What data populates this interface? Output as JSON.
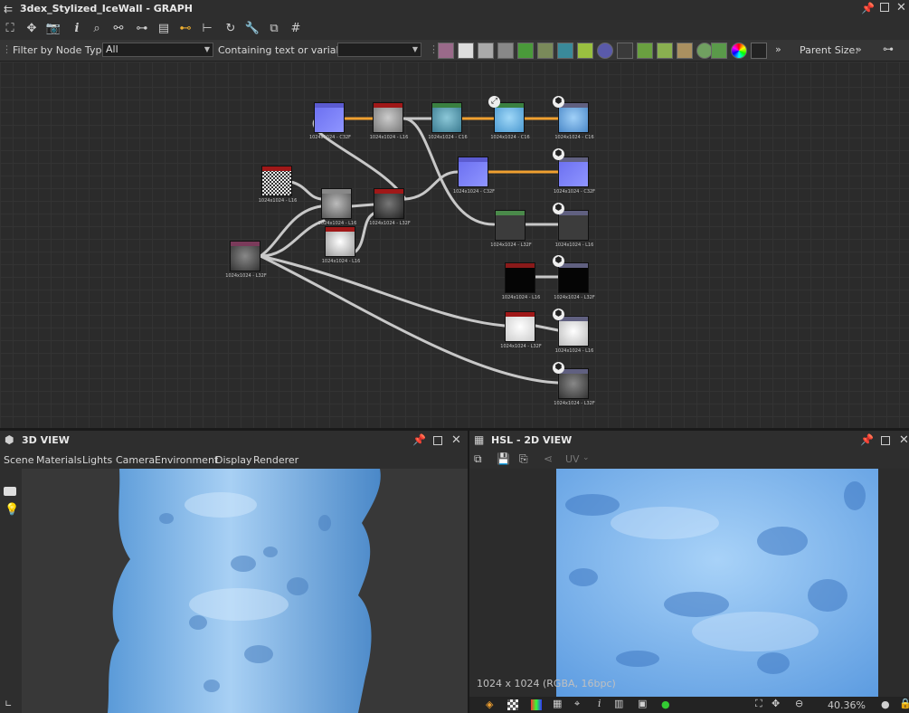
{
  "graph": {
    "title": "3dex_Stylized_IceWall - GRAPH",
    "filter_label": "Filter by Node Type",
    "filter_value": "All",
    "containing_label": "Containing text or variable",
    "containing_value": "",
    "parent_size_label": "Parent Size:",
    "nodes": [
      {
        "label": "1024x1024 - C32F"
      },
      {
        "label": "1024x1024 - L16"
      },
      {
        "label": "1024x1024 - C16"
      },
      {
        "label": "1024x1024 - C16"
      },
      {
        "label": "1024x1024 - C16"
      },
      {
        "label": "1024x1024 - C32F"
      },
      {
        "label": "1024x1024 - C32F"
      },
      {
        "label": "1024x1024 - L16"
      },
      {
        "label": "1024x1024 - L16"
      },
      {
        "label": "1024x1024 - L16"
      },
      {
        "label": "1024x1024 - L32F"
      },
      {
        "label": "1024x1024 - L32F"
      },
      {
        "label": "1024x1024 - L32F"
      },
      {
        "label": "1024x1024 - L16"
      },
      {
        "label": "1024x1024 - L16"
      },
      {
        "label": "1024x1024 - L32F"
      },
      {
        "label": "1024x1024 - L32F"
      },
      {
        "label": "1024x1024 - L16"
      },
      {
        "label": "1024x1024 - L32F"
      }
    ]
  },
  "view3d": {
    "title": "3D VIEW",
    "menu": [
      "Scene",
      "Materials",
      "Lights",
      "Camera",
      "Environment",
      "Display",
      "Renderer"
    ]
  },
  "view2d": {
    "title": "HSL - 2D VIEW",
    "uv_label": "UV",
    "image_info": "1024 x 1024 (RGBA, 16bpc)",
    "zoom": "40.36%"
  },
  "colors": {
    "panel": "#2e2e2e",
    "canvas": "#2b2b2b",
    "ice": "#7fb8ea",
    "wire": "#c8c8c8",
    "wire_active": "#f0a030"
  }
}
